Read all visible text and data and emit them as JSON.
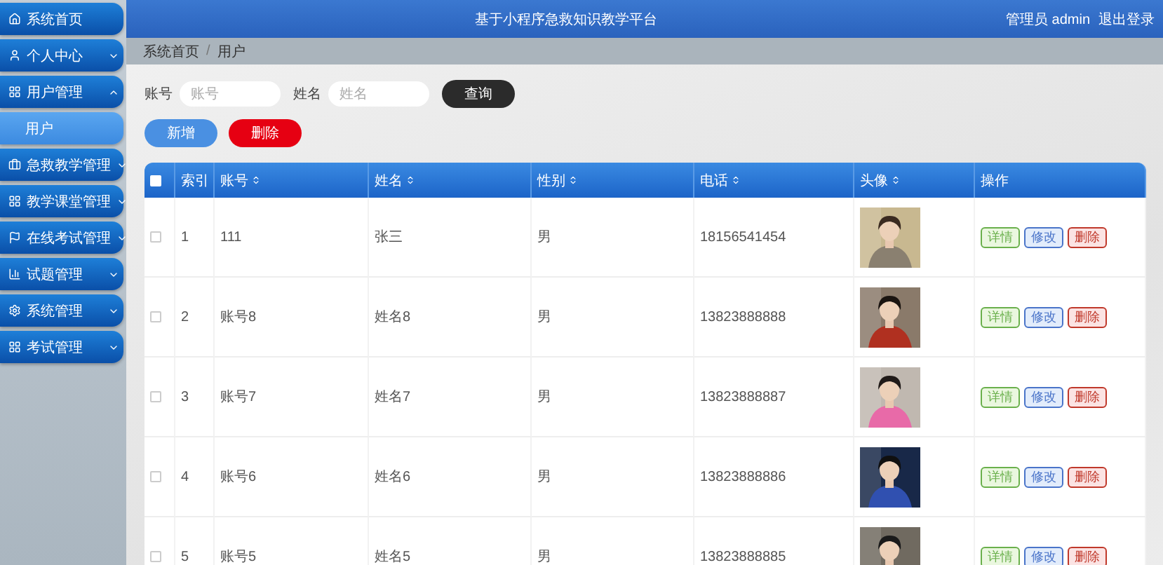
{
  "header": {
    "title": "基于小程序急救知识教学平台",
    "user": "管理员 admin",
    "logout": "退出登录"
  },
  "sidebar": {
    "items": [
      {
        "label": "系统首页"
      },
      {
        "label": "个人中心",
        "expanded": false
      },
      {
        "label": "用户管理",
        "expanded": true,
        "children": [
          {
            "label": "用户",
            "selected": true
          }
        ]
      },
      {
        "label": "急救教学管理",
        "expanded": false
      },
      {
        "label": "教学课堂管理",
        "expanded": false
      },
      {
        "label": "在线考试管理",
        "expanded": false
      },
      {
        "label": "试题管理",
        "expanded": false
      },
      {
        "label": "系统管理",
        "expanded": false
      },
      {
        "label": "考试管理",
        "expanded": false
      }
    ]
  },
  "breadcrumb": {
    "separator": "/",
    "items": [
      "系统首页",
      "用户"
    ]
  },
  "search": {
    "fields": [
      {
        "label": "账号",
        "placeholder": "账号"
      },
      {
        "label": "姓名",
        "placeholder": "姓名"
      }
    ],
    "button": "查询"
  },
  "actions": [
    "新增",
    "删除"
  ],
  "table": {
    "select_all_checked": false,
    "columns": [
      {
        "label": "索引",
        "sortable": false
      },
      {
        "label": "账号",
        "sortable": true
      },
      {
        "label": "姓名",
        "sortable": true
      },
      {
        "label": "性别",
        "sortable": true
      },
      {
        "label": "电话",
        "sortable": true
      },
      {
        "label": "头像",
        "sortable": true
      },
      {
        "label": "操作",
        "sortable": false
      }
    ],
    "rows": [
      {
        "checked": false,
        "cells": [
          "1",
          "111",
          "张三",
          "男",
          "18156541454"
        ],
        "buttons": [
          "详情",
          "修改",
          "删除"
        ]
      },
      {
        "checked": false,
        "cells": [
          "2",
          "账号8",
          "姓名8",
          "男",
          "13823888888"
        ],
        "buttons": [
          "详情",
          "修改",
          "删除"
        ]
      },
      {
        "checked": false,
        "cells": [
          "3",
          "账号7",
          "姓名7",
          "男",
          "13823888887"
        ],
        "buttons": [
          "详情",
          "修改",
          "删除"
        ]
      },
      {
        "checked": false,
        "cells": [
          "4",
          "账号6",
          "姓名6",
          "男",
          "13823888886"
        ],
        "buttons": [
          "详情",
          "修改",
          "删除"
        ]
      },
      {
        "checked": false,
        "cells": [
          "5",
          "账号5",
          "姓名5",
          "男",
          "13823888885"
        ],
        "buttons": [
          "详情",
          "修改",
          "删除"
        ]
      }
    ]
  }
}
